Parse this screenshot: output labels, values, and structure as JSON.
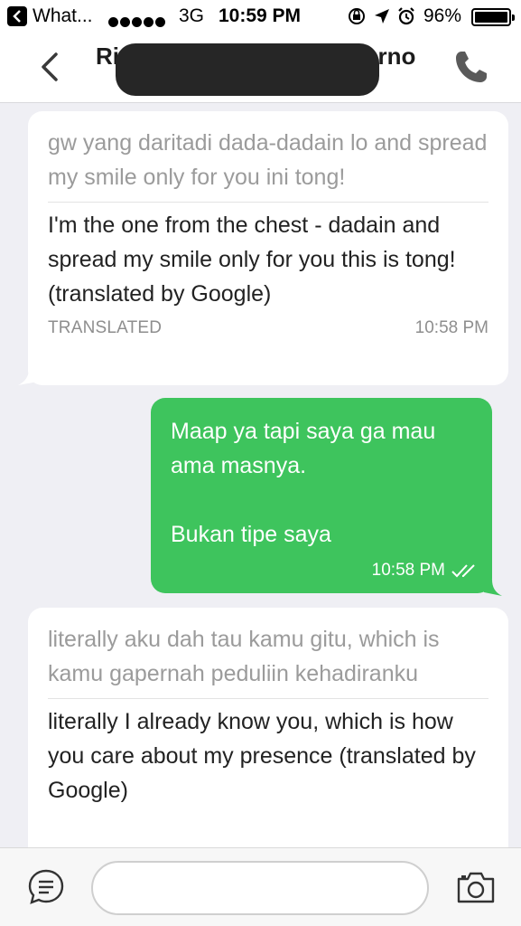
{
  "status_bar": {
    "back_app": "What...",
    "network": "3G",
    "time": "10:59 PM",
    "battery": "96%"
  },
  "header": {
    "contact_name_visible_start": "Ri",
    "contact_name_visible_end": "erno"
  },
  "messages": [
    {
      "direction": "incoming",
      "original": "gw yang daritadi dada-dadain lo and spread my smile only for you ini tong!",
      "translation": "I'm the one from the chest - dadain and spread my smile only for you this is tong! (translated by Google)",
      "tag": "TRANSLATED",
      "time": "10:58 PM"
    },
    {
      "direction": "outgoing",
      "text": "Maap ya tapi saya ga mau ama masnya.\n\nBukan tipe saya",
      "time": "10:58 PM",
      "status": "read"
    },
    {
      "direction": "incoming",
      "original": "literally aku dah tau kamu gitu, which is kamu gapernah peduliin kehadiranku",
      "translation": "literally I already know you, which is how you care about my presence (translated by Google)"
    }
  ],
  "input": {
    "value": "",
    "placeholder": ""
  },
  "colors": {
    "outgoing_bubble": "#3ec45d",
    "incoming_bubble": "#ffffff",
    "background": "#efeff4"
  }
}
